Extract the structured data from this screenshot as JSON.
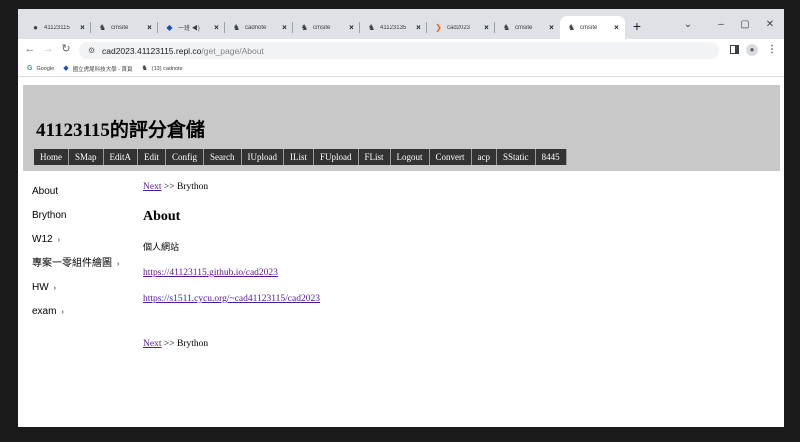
{
  "browser": {
    "tabs": [
      {
        "title": "41123115",
        "icon": "github-icon",
        "active": false
      },
      {
        "title": "cmsite",
        "icon": "cms-icon",
        "active": false
      },
      {
        "title": "一班",
        "icon": "audio-tab-icon",
        "active": false
      },
      {
        "title": "cadnote",
        "icon": "cms-icon",
        "active": false
      },
      {
        "title": "cmsite",
        "icon": "cms-icon",
        "active": false
      },
      {
        "title": "41123135",
        "icon": "cms-icon",
        "active": false
      },
      {
        "title": "cad2023",
        "icon": "replit-icon",
        "active": false
      },
      {
        "title": "cmsite",
        "icon": "cms-icon",
        "active": false
      },
      {
        "title": "cmsite",
        "icon": "cms-icon",
        "active": true
      }
    ],
    "new_tab": "+",
    "url_host": "cad2023.41123115.repl.co",
    "url_path": "/get_page/About",
    "bookmarks": [
      {
        "label": "Google",
        "icon": "google-icon"
      },
      {
        "label": "國立虎尾科技大學 - 首頁",
        "icon": "school-icon"
      },
      {
        "label": "(13) cadnote",
        "icon": "cms-icon"
      }
    ]
  },
  "site": {
    "title": "41123115的評分倉儲",
    "menu": [
      "Home",
      "SMap",
      "EditA",
      "Edit",
      "Config",
      "Search",
      "IUpload",
      "IList",
      "FUpload",
      "FList",
      "Logout",
      "Convert",
      "acp",
      "SStatic",
      "8445"
    ],
    "sidebar": [
      {
        "label": "About",
        "caret": ""
      },
      {
        "label": "Brython",
        "caret": ""
      },
      {
        "label": "W12",
        "caret": "›"
      },
      {
        "label": "專案一零組件繪圖",
        "caret": "›"
      },
      {
        "label": "HW",
        "caret": "›"
      },
      {
        "label": "exam",
        "caret": "›"
      }
    ]
  },
  "content": {
    "nav_link": "Next",
    "nav_sep": ">>",
    "nav_target": "Brython",
    "heading": "About",
    "description": "個人網站",
    "link1": "https://41123115.github.io/cad2023",
    "link2": "https://s1511.cycu.org/~cad41123115/cad2023"
  }
}
